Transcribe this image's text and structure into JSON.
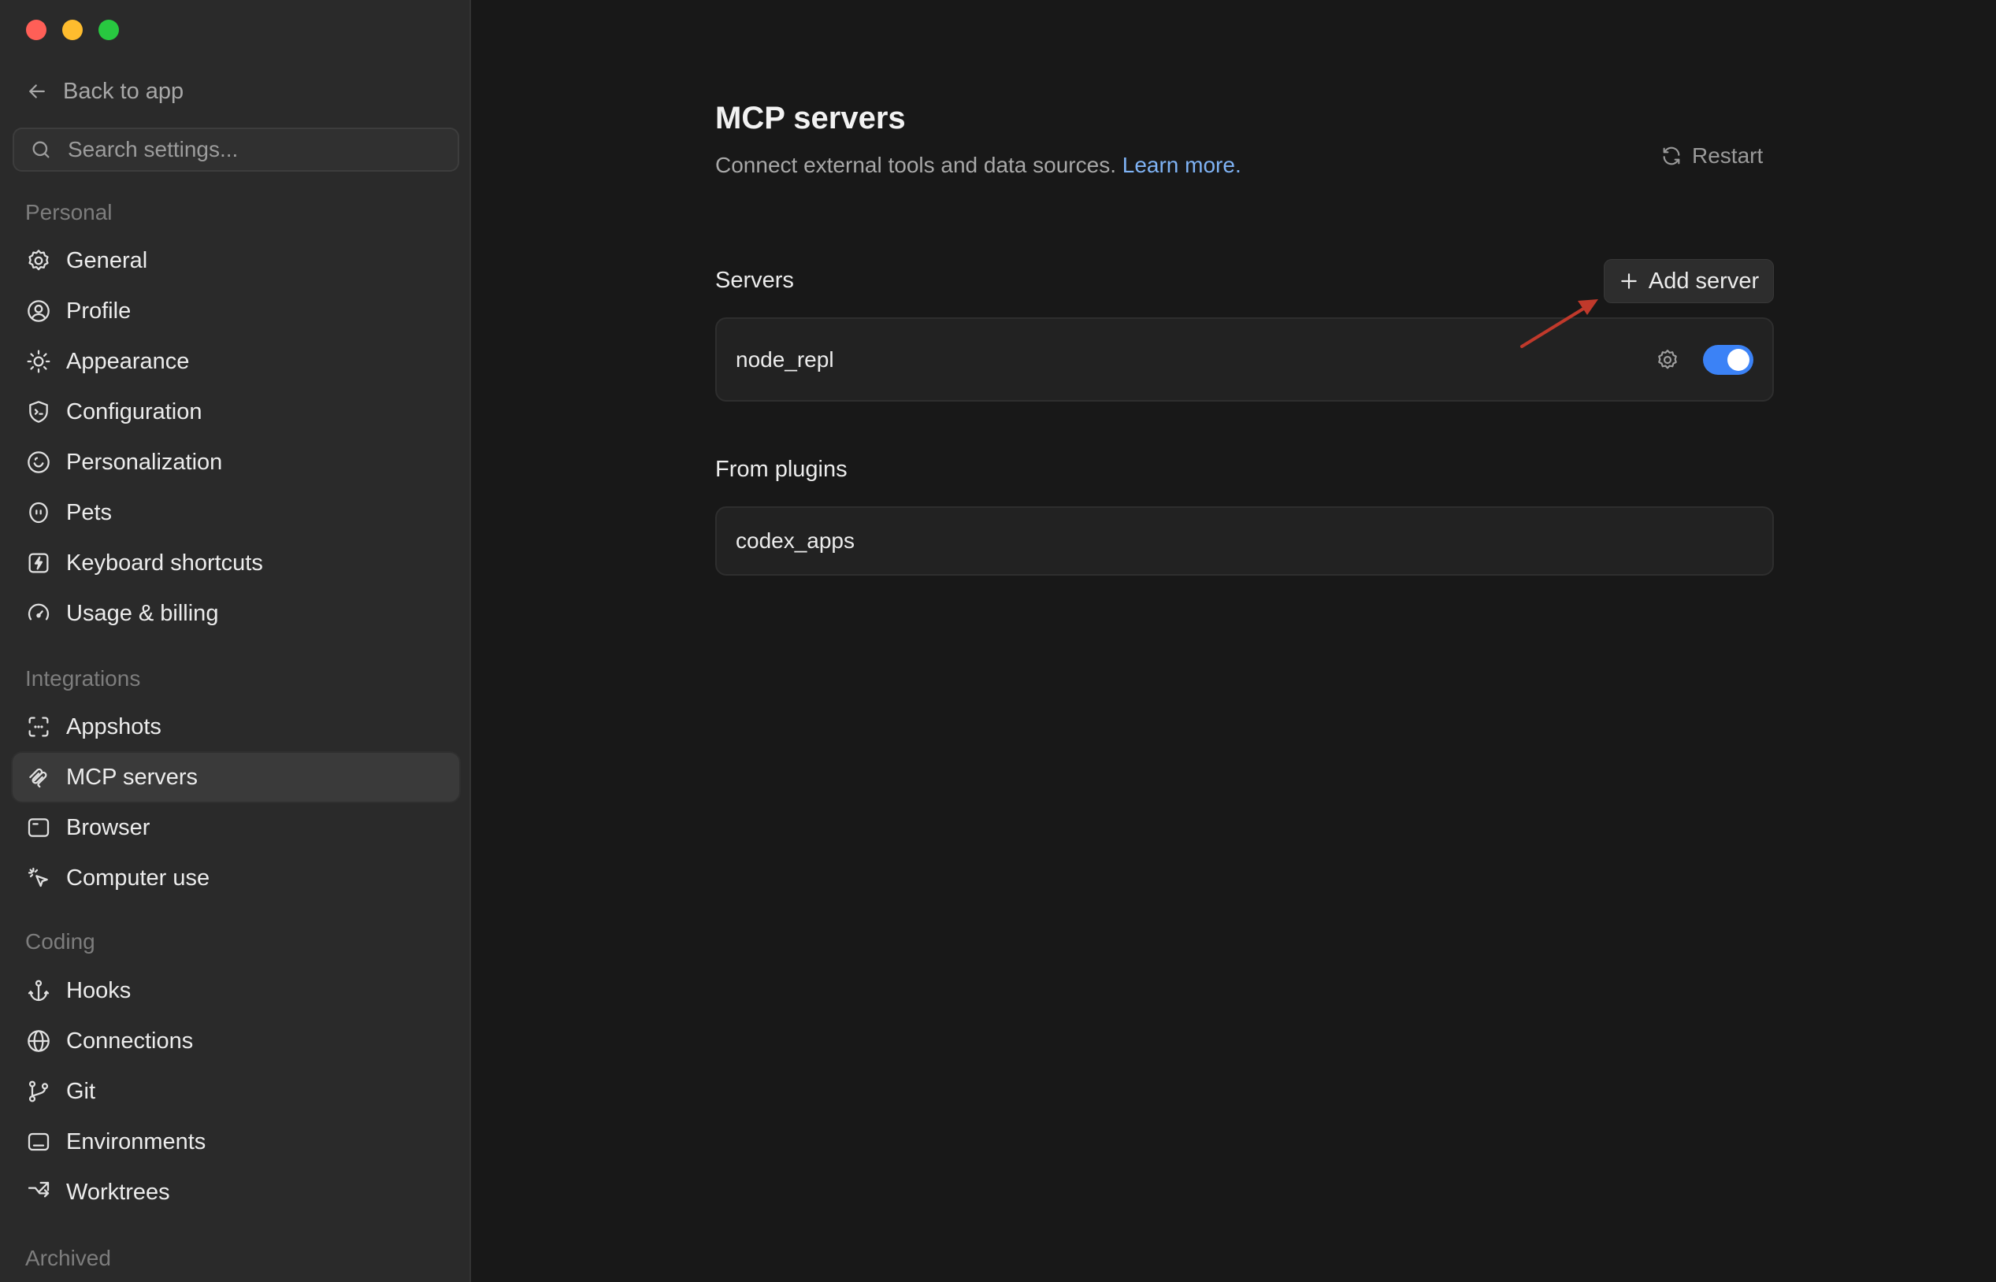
{
  "sidebar": {
    "back_label": "Back to app",
    "search_placeholder": "Search settings...",
    "sections": {
      "personal": "Personal",
      "integrations": "Integrations",
      "coding": "Coding",
      "archived": "Archived"
    },
    "items": {
      "general": "General",
      "profile": "Profile",
      "appearance": "Appearance",
      "configuration": "Configuration",
      "personalization": "Personalization",
      "pets": "Pets",
      "keyboard_shortcuts": "Keyboard shortcuts",
      "usage_billing": "Usage & billing",
      "appshots": "Appshots",
      "mcp_servers": "MCP servers",
      "browser": "Browser",
      "computer_use": "Computer use",
      "hooks": "Hooks",
      "connections": "Connections",
      "git": "Git",
      "environments": "Environments",
      "worktrees": "Worktrees"
    },
    "active_item": "MCP servers"
  },
  "main": {
    "title": "MCP servers",
    "subtitle": "Connect external tools and data sources.",
    "learn_more": "Learn more.",
    "restart_label": "Restart",
    "servers_heading": "Servers",
    "add_server_label": "Add server",
    "servers": [
      {
        "name": "node_repl",
        "enabled": true
      }
    ],
    "plugins_heading": "From plugins",
    "plugins": [
      {
        "name": "codex_apps"
      }
    ]
  },
  "colors": {
    "accent": "#3b82f6",
    "link": "#7fb3f5",
    "annotation_arrow": "#c0392b"
  }
}
